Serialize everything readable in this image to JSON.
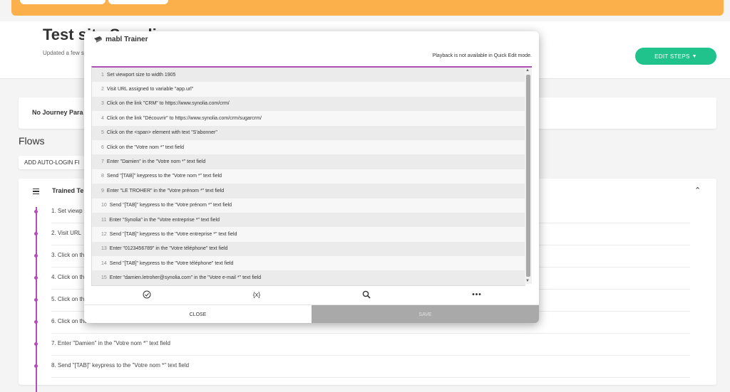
{
  "header": {
    "title": "Test site Synolia",
    "subtitle": "Updated a few s",
    "edit_steps_label": "EDIT STEPS"
  },
  "journey": {
    "label": "No Journey Para"
  },
  "flows": {
    "title": "Flows",
    "add_autologin_label": "ADD AUTO-LOGIN FI",
    "trained_title": "Trained Te",
    "steps": [
      "1. Set viewp",
      "2. Visit URL",
      "3. Click on th",
      "4. Click on th",
      "5. Click on th",
      "6. Click on the \"Votre nom *\" text field",
      "7. Enter \"Damien\" in the \"Votre nom *\" text field",
      "8. Send \"[TAB]\" keypress to the \"Votre nom *\" text field"
    ]
  },
  "modal": {
    "title": "mabl Trainer",
    "playback_note": "Playback is not available in Quick Edit mode.",
    "steps": [
      {
        "num": "1",
        "text": "Set viewport size to width 1905"
      },
      {
        "num": "2",
        "text": "Visit URL assigned to variable \"app.url\""
      },
      {
        "num": "3",
        "text": "Click on the link \"CRM\" to https://www.synolia.com/crm/"
      },
      {
        "num": "4",
        "text": "Click on the link \"Découvrir\" to https://www.synolia.com/crm/sugarcrm/"
      },
      {
        "num": "5",
        "text": "Click on the <span> element with text \"S'abonner\""
      },
      {
        "num": "6",
        "text": "Click on the \"Votre nom *\" text field"
      },
      {
        "num": "7",
        "text": "Enter \"Damien\" in the \"Votre nom *\" text field"
      },
      {
        "num": "8",
        "text": "Send \"[TAB]\" keypress to the \"Votre nom *\" text field"
      },
      {
        "num": "9",
        "text": "Enter \"LE TROHER\" in the \"Votre prénom *\" text field"
      },
      {
        "num": "10",
        "text": "Send \"[TAB]\" keypress to the \"Votre prénom *\" text field"
      },
      {
        "num": "11",
        "text": "Enter \"Synolia\" in the \"Votre entreprise *\" text field"
      },
      {
        "num": "12",
        "text": "Send \"[TAB]\" keypress to the \"Votre entreprise *\" text field"
      },
      {
        "num": "13",
        "text": "Enter \"0123456789\" in the \"Votre téléphone\" text field"
      },
      {
        "num": "14",
        "text": "Send \"[TAB]\" keypress to the \"Votre téléphone\" text field"
      },
      {
        "num": "15",
        "text": "Enter \"damien.letroher@synolia.com\" in the \"Votre e-mail *\" text field"
      }
    ],
    "toolbar": {
      "variables_label": "{x}",
      "more_label": "•••"
    },
    "close_label": "CLOSE",
    "save_label": "SAVE"
  },
  "colors": {
    "accent": "#b24fb5",
    "brand_green": "#1fc38b",
    "banner_orange": "#fcb04b"
  },
  "icons": [
    "mabl-logo-icon",
    "check-circle-icon",
    "variables-icon",
    "search-icon",
    "more-icon",
    "menu-icon",
    "chevron-up-icon",
    "caret-down-icon"
  ]
}
